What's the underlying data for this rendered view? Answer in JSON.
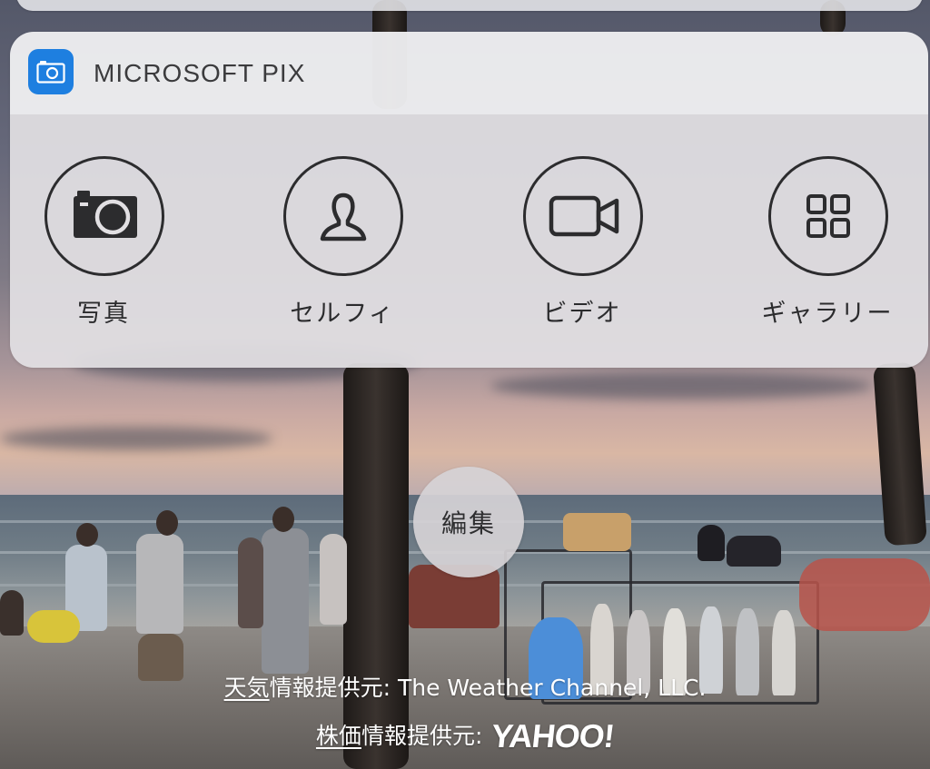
{
  "widget": {
    "app_name": "MICROSOFT PIX",
    "app_icon": "camera-icon",
    "accent_color": "#1e7fe0",
    "actions": [
      {
        "label": "写真",
        "icon": "camera-icon"
      },
      {
        "label": "セルフィ",
        "icon": "person-icon"
      },
      {
        "label": "ビデオ",
        "icon": "video-camera-icon"
      },
      {
        "label": "ギャラリー",
        "icon": "grid-icon"
      }
    ]
  },
  "edit_button": {
    "label": "編集"
  },
  "attribution": {
    "weather_link": "天気",
    "weather_text": "情報提供元: The Weather Channel, LLC.",
    "stock_link": "株価",
    "stock_text": "情報提供元:",
    "stock_provider": "YAHOO!"
  }
}
